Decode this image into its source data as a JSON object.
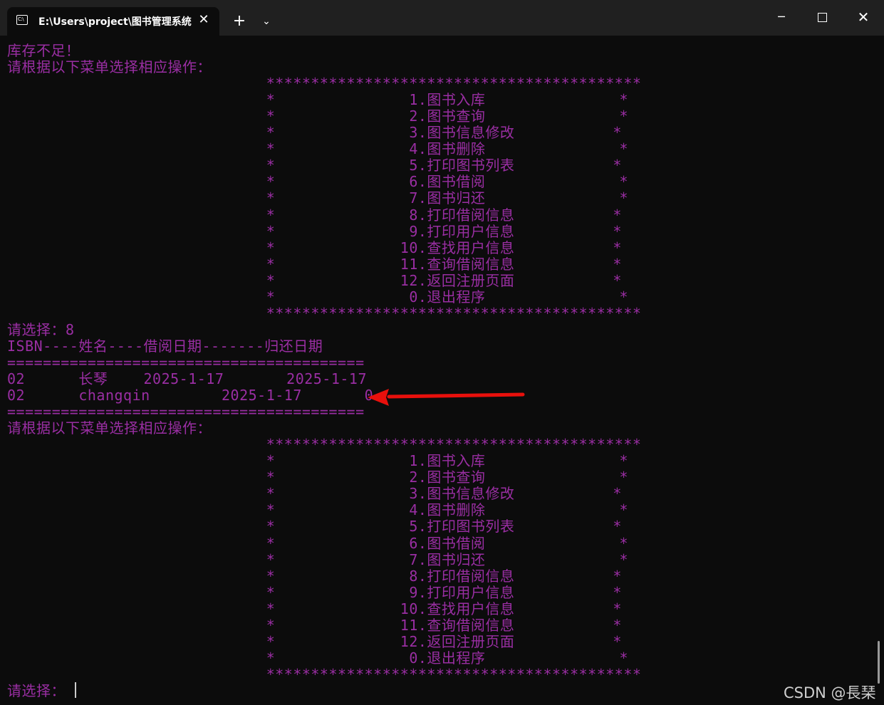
{
  "window": {
    "tab_title": "E:\\Users\\project\\图书管理系统",
    "tab_close_glyph": "✕",
    "new_tab_glyph": "+",
    "dropdown_glyph": "⌄",
    "minimize_glyph": "─",
    "close_glyph": "✕",
    "icon": "terminal-icon"
  },
  "console_lines": [
    "库存不足！",
    "请根据以下菜单选择相应操作：",
    "                             ******************************************",
    "                             *               1.图书入库               *",
    "                             *               2.图书查询               *",
    "                             *               3.图书信息修改           *",
    "                             *               4.图书删除               *",
    "                             *               5.打印图书列表           *",
    "                             *               6.图书借阅               *",
    "                             *               7.图书归还               *",
    "                             *               8.打印借阅信息           *",
    "                             *               9.打印用户信息           *",
    "                             *              10.查找用户信息           *",
    "                             *              11.查询借阅信息           *",
    "                             *              12.返回注册页面           *",
    "                             *               0.退出程序               *",
    "                             ******************************************",
    "请选择：8",
    "ISBN----姓名----借阅日期-------归还日期",
    "========================================",
    "02      长琴    2025-1-17       2025-1-17",
    "02      changqin        2025-1-17       0",
    "========================================",
    "请根据以下菜单选择相应操作：",
    "                             ******************************************",
    "                             *               1.图书入库               *",
    "                             *               2.图书查询               *",
    "                             *               3.图书信息修改           *",
    "                             *               4.图书删除               *",
    "                             *               5.打印图书列表           *",
    "                             *               6.图书借阅               *",
    "                             *               7.图书归还               *",
    "                             *               8.打印借阅信息           *",
    "                             *               9.打印用户信息           *",
    "                             *              10.查找用户信息           *",
    "                             *              11.查询借阅信息           *",
    "                             *              12.返回注册页面           *",
    "                             *               0.退出程序               *",
    "                             ******************************************",
    "请选择："
  ],
  "watermark": "CSDN @長琹",
  "colors": {
    "console_text": "#9a2ea3",
    "background": "#0c0c0c",
    "titlebar": "#202020",
    "annotation_arrow": "#e8100c"
  }
}
